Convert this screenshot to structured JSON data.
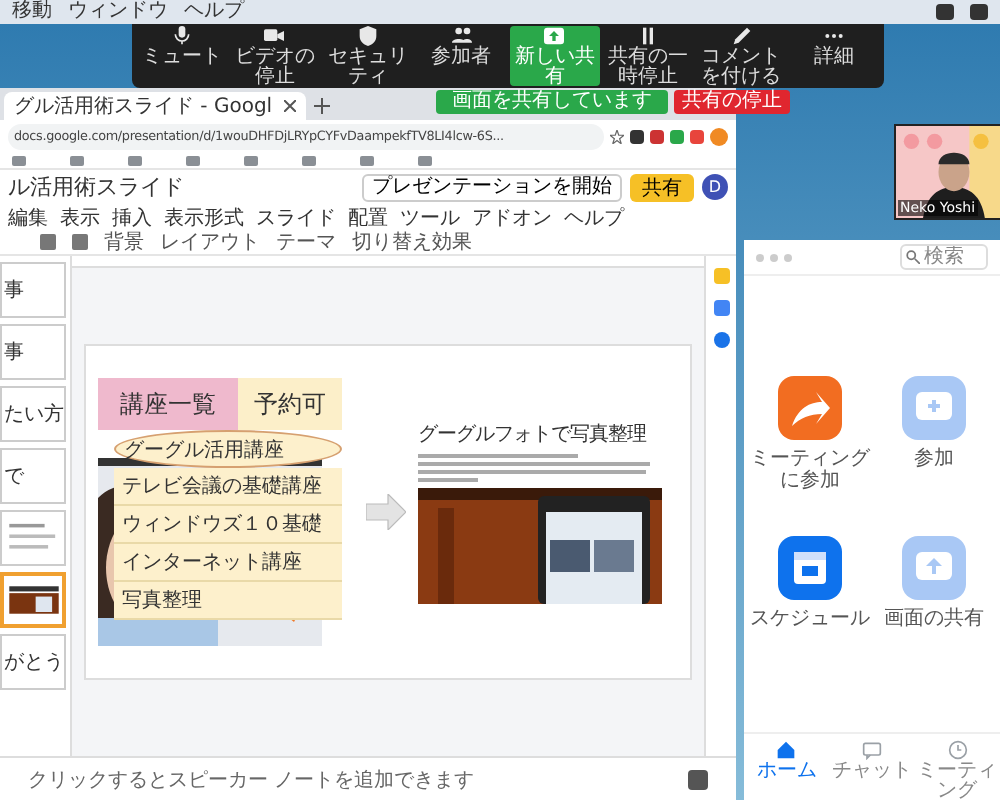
{
  "menu_bar": {
    "items": [
      "移動",
      "ウィンドウ",
      "ヘルプ"
    ]
  },
  "meeting_toolbar": {
    "buttons": [
      {
        "label": "ミュート",
        "kind": "mic",
        "active": false
      },
      {
        "label": "ビデオの停止",
        "kind": "camera",
        "active": false
      },
      {
        "label": "セキュリティ",
        "kind": "shield",
        "active": false
      },
      {
        "label": "参加者",
        "kind": "people",
        "active": false
      },
      {
        "label": "新しい共有",
        "kind": "share",
        "active": true
      },
      {
        "label": "共有の一時停止",
        "kind": "pause",
        "active": false
      },
      {
        "label": "コメントを付ける",
        "kind": "pencil",
        "active": false
      },
      {
        "label": "詳細",
        "kind": "dots",
        "active": false
      }
    ]
  },
  "share_banner": {
    "status": "画面を共有しています",
    "stop": "共有の停止"
  },
  "browser": {
    "tab": {
      "title": "グル活用術スライド - Googl"
    },
    "url": "docs.google.com/presentation/d/1wouDHFDjLRYpCYFvDaampekfTV8LI4lcw-6S...",
    "doc_title": "ル活用術スライド",
    "menus": [
      "編集",
      "表示",
      "挿入",
      "表示形式",
      "スライド",
      "配置",
      "ツール",
      "アドオン",
      "ヘルプ"
    ],
    "present_button": "プレゼンテーションを開始",
    "share_button": "共有",
    "account_initial": "D",
    "toolbar": [
      "背景",
      "レイアウト",
      "テーマ",
      "切り替え効果"
    ],
    "filmstrip": [
      {
        "kind": "text",
        "text": "事",
        "selected": false
      },
      {
        "kind": "text",
        "text": "事",
        "selected": false
      },
      {
        "kind": "text",
        "text": "たい方",
        "selected": false
      },
      {
        "kind": "text",
        "text": "で",
        "selected": false
      },
      {
        "kind": "lines",
        "selected": false
      },
      {
        "kind": "picture",
        "selected": true
      },
      {
        "kind": "text",
        "text": "がとう",
        "selected": false
      }
    ],
    "slide": {
      "headers": [
        "講座一覧",
        "予約可"
      ],
      "courses": [
        {
          "label": "グーグル活用講座",
          "circled": true
        },
        {
          "label": "テレビ会議の基礎講座",
          "circled": false
        },
        {
          "label": "ウィンドウズ１０基礎",
          "circled": false
        },
        {
          "label": "インターネット講座",
          "circled": false
        },
        {
          "label": "写真整理",
          "circled": false
        }
      ],
      "heading": "グーグルフォトで写真整理"
    },
    "notes_placeholder": "クリックするとスピーカー ノートを追加できます"
  },
  "video": {
    "name": "Neko Yoshi"
  },
  "zoom_app": {
    "search_placeholder": "検索",
    "actions": [
      {
        "label": "ミーティングに参加",
        "color": "#f26d21",
        "kind": "join"
      },
      {
        "label": "参加",
        "color": "#a9c8f5",
        "kind": "plus"
      },
      {
        "label": "スケジュール",
        "color": "#0e72ed",
        "kind": "calendar"
      },
      {
        "label": "画面の共有",
        "color": "#a9c8f5",
        "kind": "share"
      }
    ],
    "nav": [
      {
        "label": "ホーム",
        "kind": "home",
        "selected": true
      },
      {
        "label": "チャット",
        "kind": "chat",
        "selected": false
      },
      {
        "label": "ミーティング",
        "kind": "clock",
        "selected": false
      }
    ]
  }
}
